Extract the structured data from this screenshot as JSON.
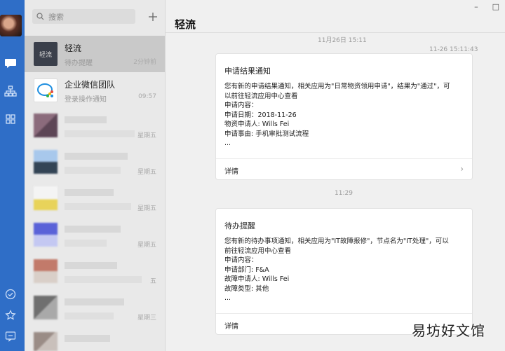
{
  "sidebar": {
    "icons": [
      "chat-icon",
      "org-icon",
      "apps-icon",
      "todo-icon",
      "favorites-icon",
      "feedback-icon"
    ]
  },
  "search": {
    "placeholder": "搜索"
  },
  "conversations": [
    {
      "title": "轻流",
      "subtitle": "待办提醒",
      "time": "2分钟前",
      "icon_text": "轻流",
      "selected": true
    },
    {
      "title": "企业微信团队",
      "subtitle": "登录操作通知",
      "time": "09:57"
    },
    {
      "time": "星期五"
    },
    {
      "time": "星期五"
    },
    {
      "time": "星期五"
    },
    {
      "time": "星期五"
    },
    {
      "time": "五"
    },
    {
      "time": "星期三"
    }
  ],
  "chat": {
    "name": "轻流",
    "window_controls": [
      "–",
      "□"
    ],
    "timestamp_top": "11月26日 15:11",
    "messages": [
      {
        "meta_time": "11-26 15:11:43",
        "title": "申请结果通知",
        "lines": [
          "您有新的申请结果通知，相关应用为\"日常物资领用申请\"，结果为\"通过\"，可",
          "以前往轻流应用中心查看",
          "申请内容：",
          "申请日期：2018-11-26",
          "物资申请人: Wills Fei",
          "申请事由: 手机审批测试流程",
          "..."
        ],
        "detail_label": "详情"
      },
      {
        "separator_time": "11:29",
        "title": "待办提醒",
        "lines": [
          "您有新的待办事项通知，相关应用为\"IT故障报修\"，节点名为\"IT处理\"，可以",
          "前往轻流应用中心查看",
          "申请内容：",
          "申请部门: F&A",
          "故障申请人: Wills Fei",
          "故障类型: 其他",
          "..."
        ],
        "detail_label": "详情"
      }
    ]
  },
  "watermark": "易坊好文馆"
}
